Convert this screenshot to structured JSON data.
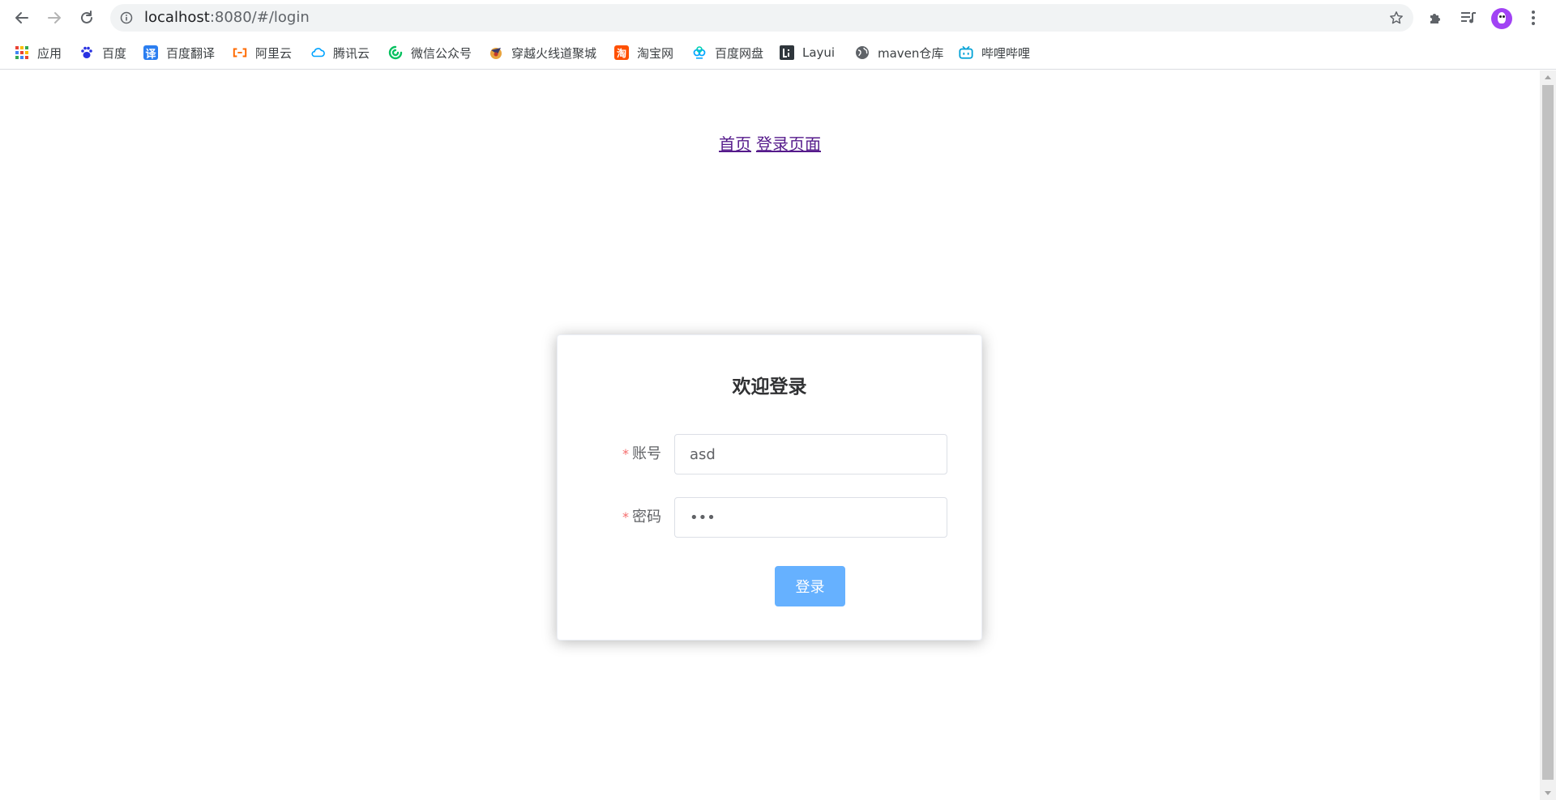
{
  "browser": {
    "url_host": "localhost",
    "url_path": ":8080/#/login"
  },
  "bookmarks": [
    {
      "label": "应用",
      "icon": "apps-grid-icon"
    },
    {
      "label": "百度",
      "icon": "baidu-paw-icon"
    },
    {
      "label": "百度翻译",
      "icon": "baidu-translate-icon",
      "glyph": "译"
    },
    {
      "label": "阿里云",
      "icon": "aliyun-icon"
    },
    {
      "label": "腾讯云",
      "icon": "tencent-cloud-icon"
    },
    {
      "label": "微信公众号",
      "icon": "wechat-official-icon"
    },
    {
      "label": "穿越火线道聚城",
      "icon": "crossfire-icon"
    },
    {
      "label": "淘宝网",
      "icon": "taobao-icon",
      "glyph": "淘"
    },
    {
      "label": "百度网盘",
      "icon": "baidu-netdisk-icon"
    },
    {
      "label": "Layui",
      "icon": "layui-icon"
    },
    {
      "label": "maven仓库",
      "icon": "globe-icon"
    },
    {
      "label": "哔哩哔哩",
      "icon": "bilibili-icon"
    }
  ],
  "nav": {
    "home_link": "首页",
    "login_link": "登录页面"
  },
  "login": {
    "title": "欢迎登录",
    "account_label": "账号",
    "account_value": "asd",
    "password_label": "密码",
    "password_value": "asd",
    "required_mark": "*",
    "submit_label": "登录"
  },
  "colors": {
    "primary_button": "#66b1ff",
    "required": "#f56c6c",
    "avatar": "#a142f4",
    "visited_link": "#551a8b"
  }
}
